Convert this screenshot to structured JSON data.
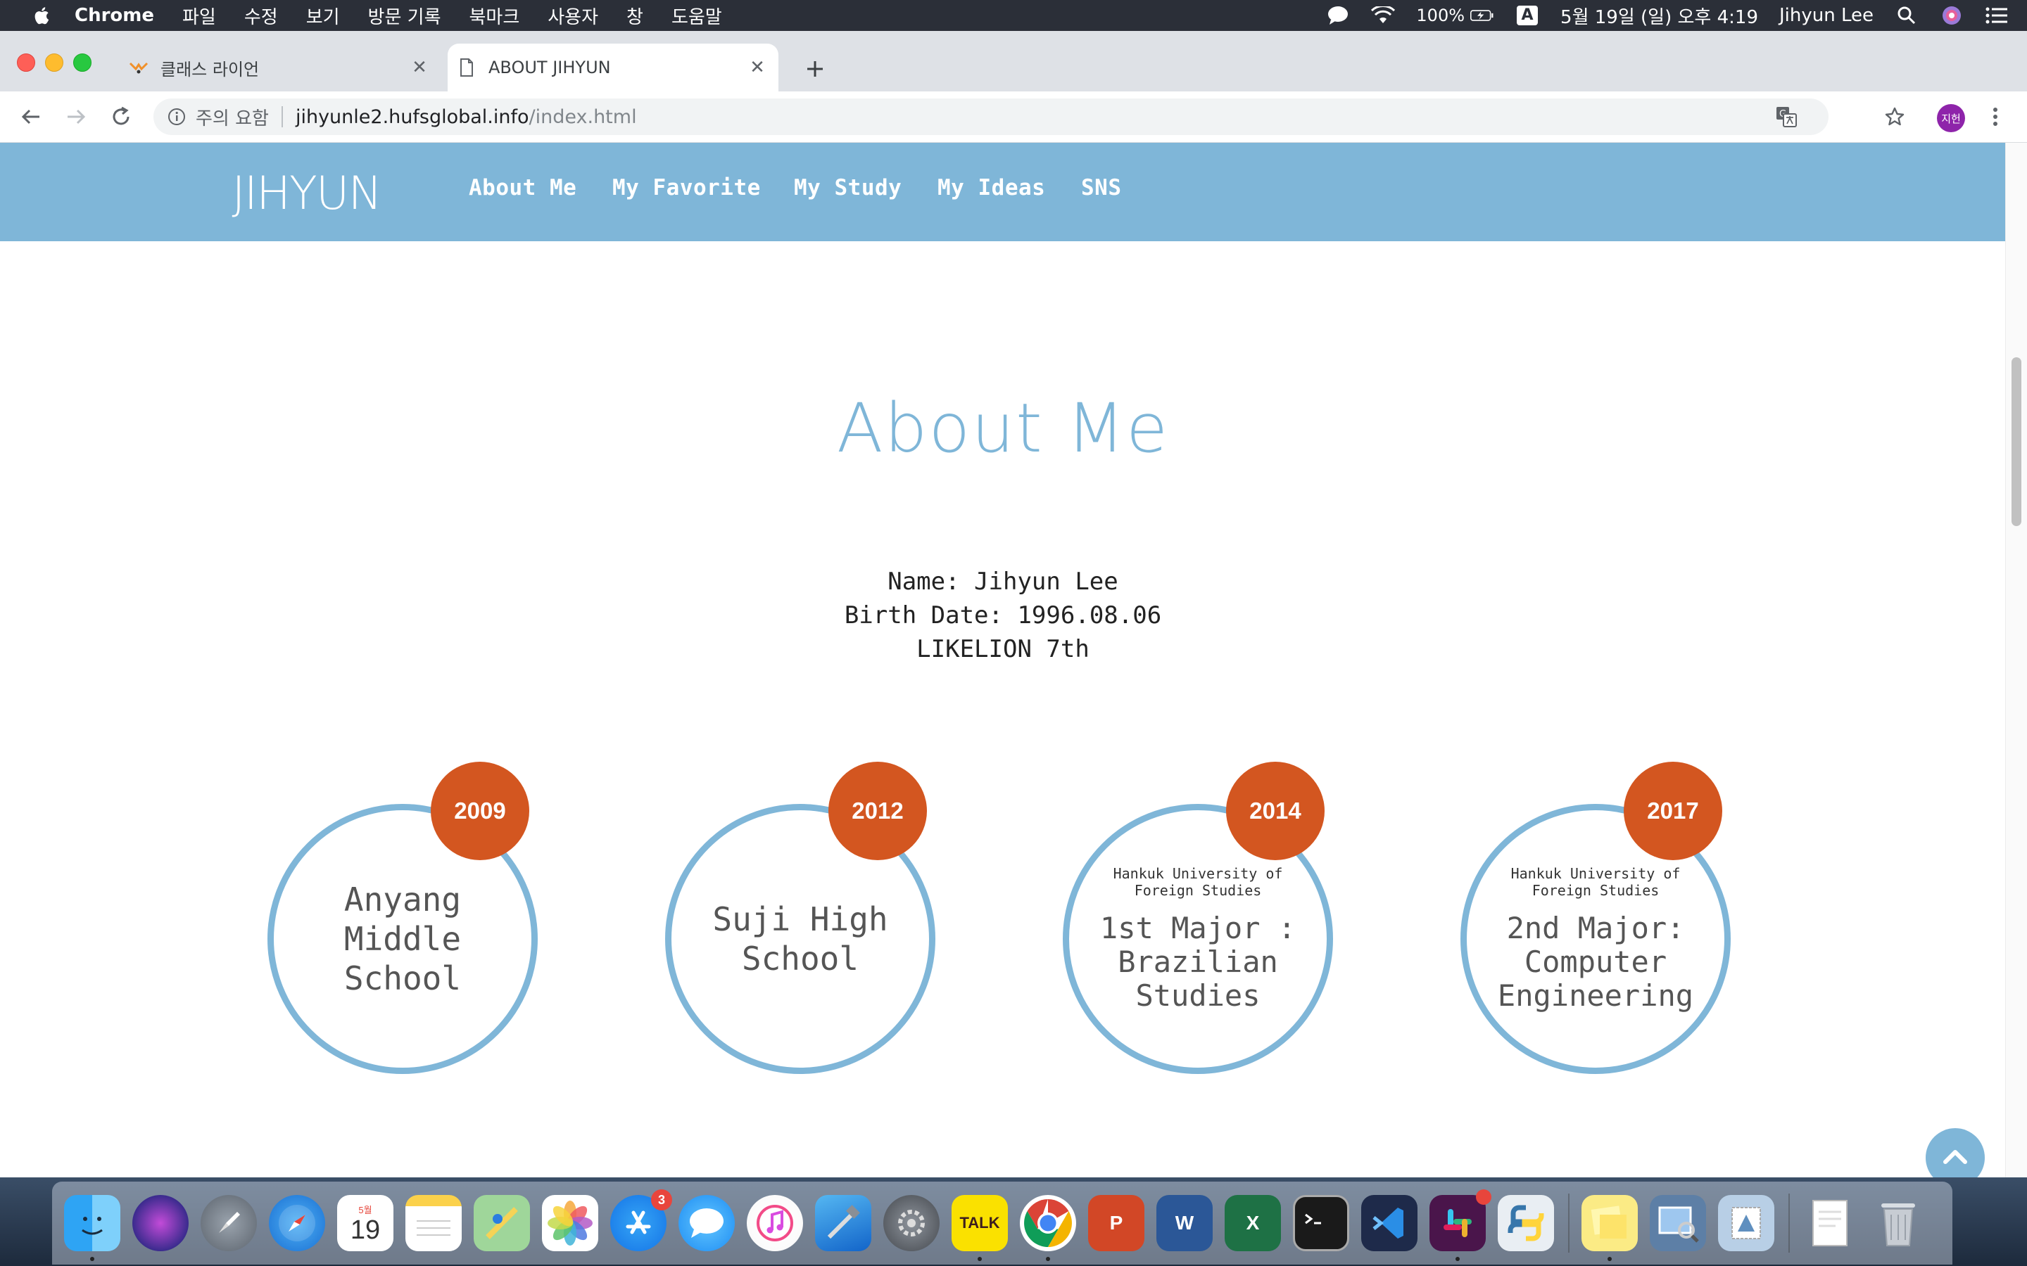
{
  "menubar": {
    "app_name": "Chrome",
    "menus": [
      "파일",
      "수정",
      "보기",
      "방문 기록",
      "북마크",
      "사용자",
      "창",
      "도움말"
    ],
    "battery": "100%",
    "input_source": "A",
    "datetime": "5월 19일 (일) 오후 4:19",
    "user": "Jihyun Lee"
  },
  "browser": {
    "tabs": [
      {
        "title": "클래스 라이언",
        "active": false,
        "icon": "lion-favicon-icon"
      },
      {
        "title": "ABOUT JIHYUN",
        "active": true,
        "icon": "page-icon"
      }
    ],
    "omnibox": {
      "security_label": "주의 요함",
      "host": "jihyunle2.hufsglobal.info",
      "path": "/index.html"
    },
    "profile_initials": "지헌"
  },
  "site": {
    "logo": "JIHYUN",
    "nav": [
      "About Me",
      "My Favorite",
      "My Study",
      "My Ideas",
      "SNS"
    ],
    "heading": "About Me",
    "info": {
      "name": "Name: Jihyun Lee",
      "birth": "Birth Date: 1996.08.06",
      "club": "LIKELION 7th"
    },
    "timeline": [
      {
        "year": "2009",
        "sub": "",
        "title_lines": [
          "Anyang",
          "Middle",
          "School"
        ]
      },
      {
        "year": "2012",
        "sub": "",
        "title_lines": [
          "Suji High",
          "School"
        ]
      },
      {
        "year": "2014",
        "sub": "Hankuk University of Foreign Studies",
        "title_lines": [
          "1st Major :",
          "Brazilian",
          "Studies"
        ]
      },
      {
        "year": "2017",
        "sub": "Hankuk University of Foreign Studies",
        "title_lines": [
          "2nd Major:",
          "Computer",
          "Engineering"
        ]
      }
    ]
  },
  "colors": {
    "accent": "#7fb6d8",
    "badge": "#d35620"
  },
  "dock": {
    "calendar_month": "5월",
    "calendar_day": "19",
    "appstore_badge": "3",
    "kakao_label": "TALK",
    "powerpoint_label": "P",
    "word_label": "W",
    "excel_label": "X"
  }
}
